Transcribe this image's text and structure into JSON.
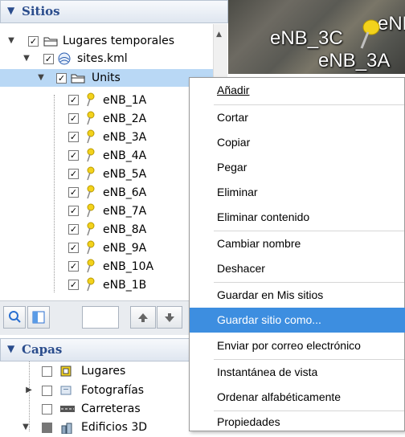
{
  "places": {
    "title": "Sitios",
    "tree": [
      {
        "label": "Lugares temporales",
        "checked": true,
        "expanded": true,
        "icon": "folder-icon"
      },
      {
        "label": "sites.kml",
        "checked": true,
        "expanded": true,
        "icon": "kml-file-icon"
      },
      {
        "label": "Units",
        "checked": true,
        "expanded": true,
        "icon": "folder-icon",
        "selected": true
      },
      {
        "label": "eNB_1A"
      },
      {
        "label": "eNB_2A"
      },
      {
        "label": "eNB_3A"
      },
      {
        "label": "eNB_4A"
      },
      {
        "label": "eNB_5A"
      },
      {
        "label": "eNB_6A"
      },
      {
        "label": "eNB_7A"
      },
      {
        "label": "eNB_8A"
      },
      {
        "label": "eNB_9A"
      },
      {
        "label": "eNB_10A"
      },
      {
        "label": "eNB_1B"
      }
    ]
  },
  "map": {
    "labels": [
      "eNB_3C",
      "eNB_3A",
      "eNB"
    ]
  },
  "layers": {
    "title": "Capas",
    "items": [
      {
        "label": "Lugares",
        "checked": false
      },
      {
        "label": "Fotografías",
        "checked": false
      },
      {
        "label": "Carreteras",
        "checked": false
      },
      {
        "label": "Edificios 3D",
        "checked": true
      }
    ]
  },
  "context_menu": {
    "items": [
      {
        "label": "Añadir",
        "underline": true
      },
      {
        "label": "Cortar"
      },
      {
        "label": "Copiar"
      },
      {
        "label": "Pegar"
      },
      {
        "label": "Eliminar"
      },
      {
        "label": "Eliminar contenido"
      },
      {
        "label": "Cambiar nombre"
      },
      {
        "label": "Deshacer"
      },
      {
        "label": "Guardar en Mis sitios"
      },
      {
        "label": "Guardar sitio como...",
        "highlighted": true
      },
      {
        "label": "Enviar por correo electrónico"
      },
      {
        "label": "Instantánea de vista"
      },
      {
        "label": "Ordenar alfabéticamente"
      },
      {
        "label": "Propiedades"
      }
    ]
  },
  "colors": {
    "selection": "#b9d8f5",
    "menu_highlight": "#3d8ee0",
    "header_text": "#2a4c8c",
    "pin_yellow": "#f3d21b"
  }
}
